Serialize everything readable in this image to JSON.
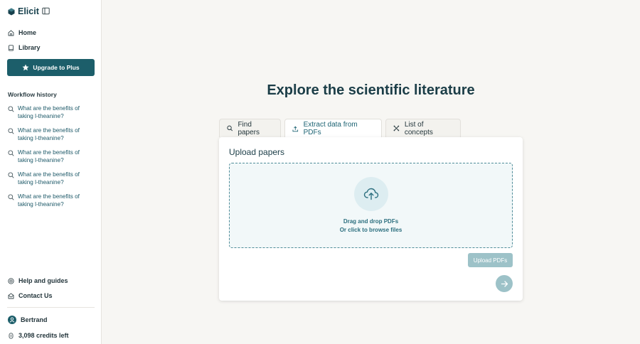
{
  "app": {
    "name": "Elicit"
  },
  "nav": {
    "home": "Home",
    "library": "Library",
    "upgrade": "Upgrade to Plus"
  },
  "history": {
    "label": "Workflow history",
    "items": [
      {
        "line1": "What are the benefits of",
        "line2": "taking l-theanine?"
      },
      {
        "line1": "What are the benefits of",
        "line2": "taking l-theanine?"
      },
      {
        "line1": "What are the benefits of",
        "line2": "taking l-theanine?"
      },
      {
        "line1": "What are the benefits of",
        "line2": "taking l-theanine?"
      },
      {
        "line1": "What are the benefits of",
        "line2": "taking l-theanine?"
      }
    ]
  },
  "footer": {
    "help": "Help and guides",
    "contact": "Contact Us",
    "user": "Bertrand",
    "credits": "3,098 credits left"
  },
  "main": {
    "title": "Explore the scientific literature",
    "tabs": [
      {
        "label": "Find papers",
        "icon": "search-icon"
      },
      {
        "label": "Extract data from PDFs",
        "icon": "upload-icon"
      },
      {
        "label": "List of concepts",
        "icon": "concepts-icon"
      }
    ],
    "active_tab": "Extract data from PDFs"
  },
  "upload": {
    "heading": "Upload papers",
    "drag_text": "Drag and drop PDFs",
    "browse_text": "Or click to browse files",
    "button": "Upload PDFs"
  },
  "colors": {
    "brand": "#1c5e6a",
    "link": "#1d5968",
    "disabled_button": "#9dc2c8",
    "background": "#f7f6f3"
  }
}
